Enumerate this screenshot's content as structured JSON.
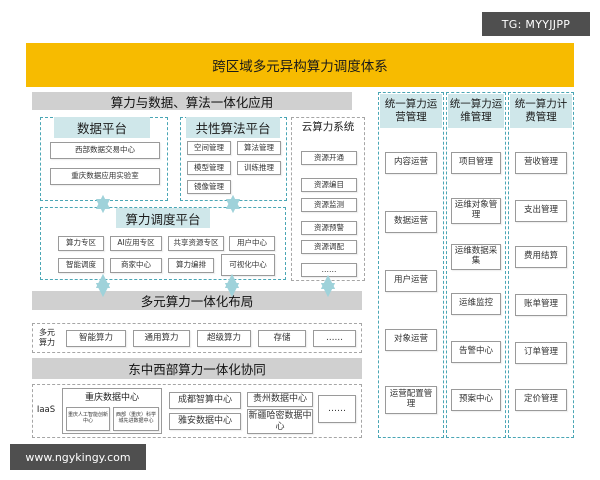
{
  "watermark_top": "TG: MYYJJPP",
  "watermark_bottom": "www.ngykingy.com",
  "banner": {
    "title": "跨区域多元异构算力调度体系",
    "color": "#f7bb00"
  },
  "app_section": {
    "title": "算力与数据、算法一体化应用",
    "data_platform": {
      "title": "数据平台",
      "items": [
        "西部数据交易中心",
        "重庆数据应用实验室"
      ]
    },
    "algo_platform": {
      "title": "共性算法平台",
      "items": [
        "空间管理",
        "算法管理",
        "模型管理",
        "训练推理",
        "镜像管理"
      ]
    },
    "cloud_system": {
      "title": "云算力系统",
      "items": [
        "资源开通",
        "资源编目",
        "资源监测",
        "资源预警",
        "资源调配",
        "……"
      ]
    }
  },
  "scheduling": {
    "title": "算力调度平台",
    "items_row1": [
      "算力专区",
      "AI应用专区",
      "共享资源专区",
      "用户中心"
    ],
    "items_row2": [
      "智能调度",
      "商家中心",
      "算力编排",
      "可视化中心"
    ]
  },
  "layout_section": {
    "title": "多元算力一体化布局",
    "label": "多元算力",
    "items": [
      "智能算力",
      "通用算力",
      "超级算力",
      "存储",
      "……"
    ]
  },
  "cooperation": {
    "title": "东中西部算力一体化协同",
    "label": "IaaS",
    "item_chongqing": "重庆数据中心",
    "item_ai_center": "重庆人工智能创新中心",
    "item_west_science": "西部（重庆）科学城先进数据中心",
    "item_chengdu": "成都智算中心",
    "item_yaan": "雅安数据中心",
    "item_guizhou": "贵州数据中心",
    "item_xinjiang": "新疆哈密数据中心",
    "item_more": "……"
  },
  "columns": [
    {
      "title": "统一算力运营管理",
      "items": [
        "内容运营",
        "数据运营",
        "用户运营",
        "对象运营",
        "运营配置管理"
      ]
    },
    {
      "title": "统一算力运维管理",
      "items": [
        "项目管理",
        "运维对象管理",
        "运维数据采集",
        "运维监控",
        "告警中心",
        "预案中心"
      ]
    },
    {
      "title": "统一算力计费管理",
      "items": [
        "营收管理",
        "支出管理",
        "费用结算",
        "账单管理",
        "订单管理",
        "定价管理"
      ]
    }
  ],
  "colors": {
    "teal": "#4aa6b5",
    "teal_fill": "#cfe7ea",
    "gray_bar": "#d0d0d0",
    "banner": "#f7bb00"
  }
}
